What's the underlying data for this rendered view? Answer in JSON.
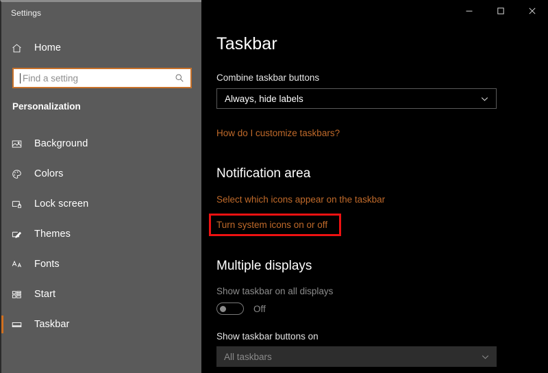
{
  "window": {
    "app_title": "Settings",
    "controls": [
      {
        "name": "minimize",
        "glyph": "─"
      },
      {
        "name": "maximize",
        "glyph": "□"
      },
      {
        "name": "close",
        "glyph": "✕"
      }
    ]
  },
  "sidebar": {
    "home": {
      "label": "Home",
      "icon": "home-icon"
    },
    "search": {
      "value": "",
      "placeholder": "Find a setting",
      "icon": "search-icon"
    },
    "group_title": "Personalization",
    "items": [
      {
        "label": "Background",
        "icon": "picture-icon",
        "selected": false
      },
      {
        "label": "Colors",
        "icon": "palette-icon",
        "selected": false
      },
      {
        "label": "Lock screen",
        "icon": "lock-screen-icon",
        "selected": false
      },
      {
        "label": "Themes",
        "icon": "themes-brush-icon",
        "selected": false
      },
      {
        "label": "Fonts",
        "icon": "fonts-icon",
        "selected": false
      },
      {
        "label": "Start",
        "icon": "start-grid-icon",
        "selected": false
      },
      {
        "label": "Taskbar",
        "icon": "taskbar-icon",
        "selected": true
      }
    ]
  },
  "main": {
    "page_title": "Taskbar",
    "combine_label": "Combine taskbar buttons",
    "combine_value": "Always, hide labels",
    "customize_link": "How do I customize taskbars?",
    "notification_head": "Notification area",
    "select_icons_link": "Select which icons appear on the taskbar",
    "system_icons_link": "Turn system icons on or off",
    "multiple_displays_head": "Multiple displays",
    "show_all_displays_label": "Show taskbar on all displays",
    "toggle_state": "Off",
    "buttons_on_label": "Show taskbar buttons on",
    "buttons_on_value": "All taskbars"
  },
  "colors": {
    "sidebar_bg": "#5a5a5a",
    "content_bg": "#000000",
    "accent_orange": "#c06a2a",
    "selection_orange": "#d07020",
    "search_border": "#c9722a",
    "highlight_red": "#ee1111"
  }
}
